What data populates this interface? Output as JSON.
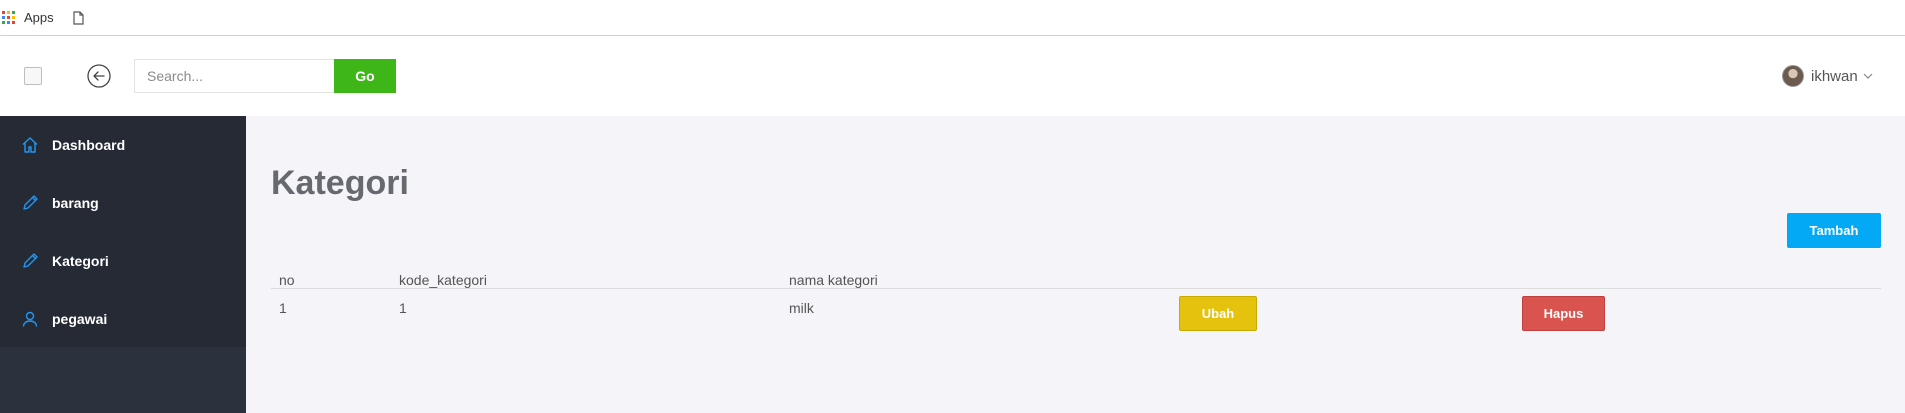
{
  "bookmarks": {
    "apps_label": "Apps",
    "apps_colors": [
      "#ea4335",
      "#fbbc05",
      "#34a853",
      "#4285f4",
      "#ea4335",
      "#fbbc05",
      "#34a853",
      "#4285f4",
      "#ea4335"
    ]
  },
  "header": {
    "search": {
      "placeholder": "Search...",
      "value": ""
    },
    "go_label": "Go",
    "user_name": "ikhwan"
  },
  "sidebar": {
    "items": [
      {
        "label": "Dashboard",
        "icon": "home-icon"
      },
      {
        "label": "barang",
        "icon": "pencil-icon"
      },
      {
        "label": "Kategori",
        "icon": "pencil-icon"
      },
      {
        "label": "pegawai",
        "icon": "user-icon"
      }
    ]
  },
  "main": {
    "title": "Kategori",
    "add_label": "Tambah",
    "table": {
      "headers": [
        "no",
        "kode_kategori",
        "nama kategori"
      ],
      "rows": [
        {
          "no": "1",
          "kode_kategori": "1",
          "nama_kategori": "milk",
          "edit_label": "Ubah",
          "delete_label": "Hapus"
        }
      ]
    }
  },
  "colors": {
    "go_button": "#3fb618",
    "tambah_button": "#03a9f4",
    "ubah_button": "#e5c20e",
    "hapus_button": "#d9534f",
    "sidebar_bg": "#252a35",
    "icon_accent": "#2196f3"
  }
}
